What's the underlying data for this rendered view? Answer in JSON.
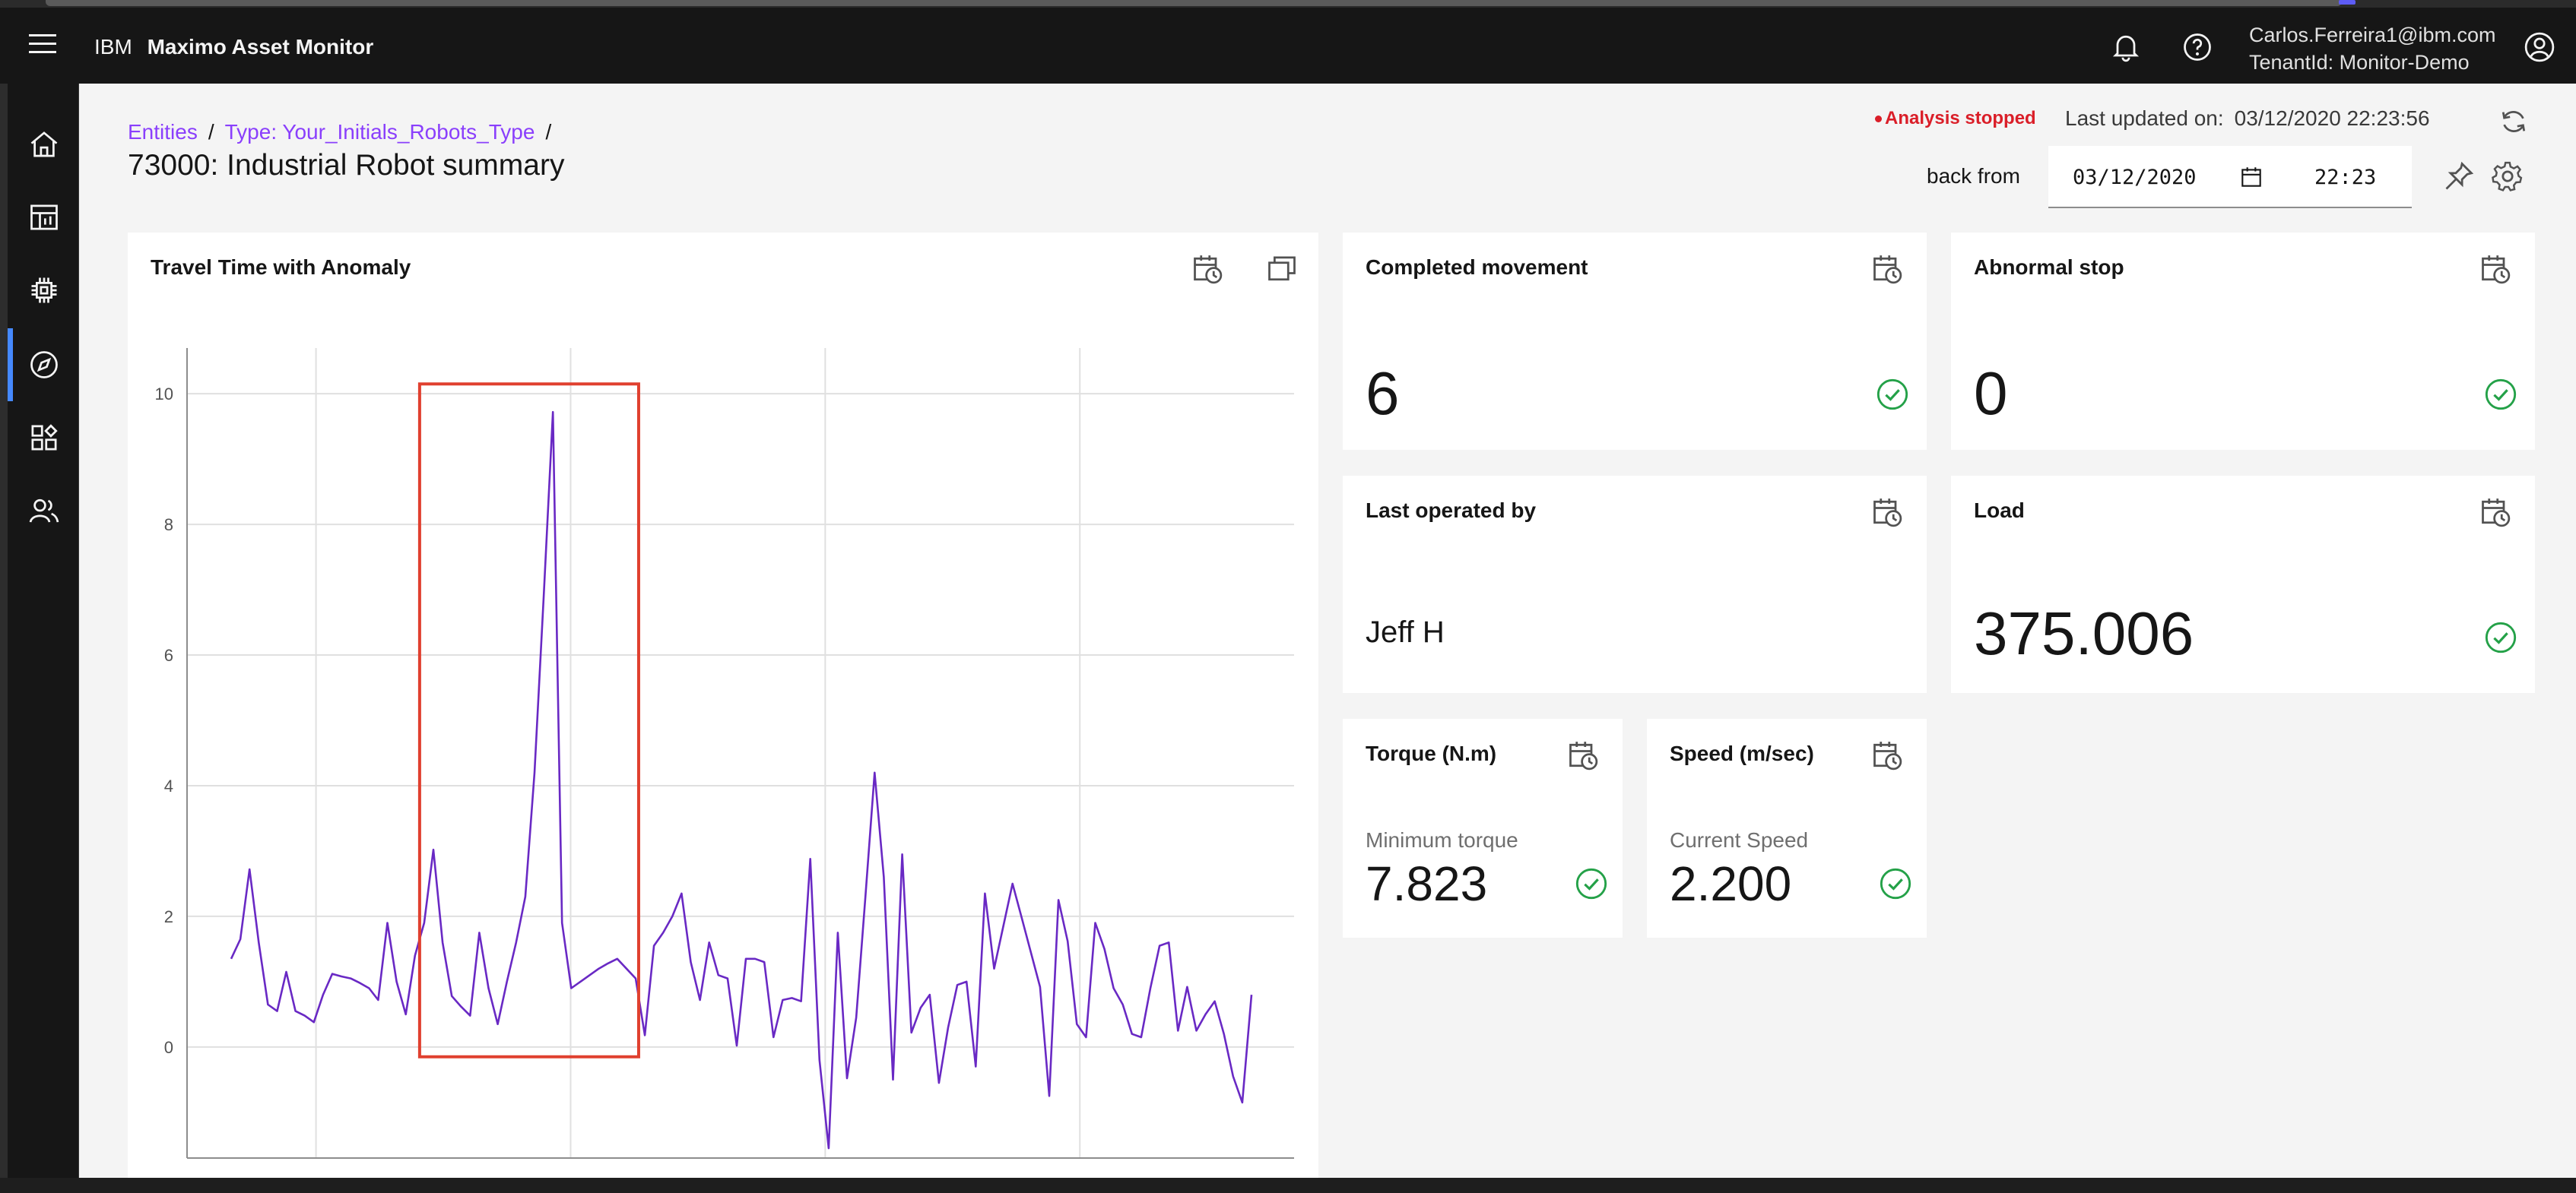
{
  "header": {
    "brand_company": "IBM",
    "brand_product": "Maximo Asset Monitor",
    "user_email": "Carlos.Ferreira1@ibm.com",
    "tenant": "TenantId: Monitor-Demo",
    "icons": [
      "notification-icon",
      "help-icon",
      "user-avatar-icon"
    ]
  },
  "leftnav": {
    "items": [
      "home-icon",
      "dashboard-icon",
      "chip-icon",
      "monitor-icon",
      "widgets-icon",
      "users-icon"
    ],
    "active": "monitor-icon"
  },
  "breadcrumb": {
    "items": [
      "Entities",
      "Type: Your_Initials_Robots_Type"
    ],
    "separator": "/"
  },
  "page": {
    "title": "73000: Industrial Robot summary",
    "status": "Analysis stopped",
    "last_updated_label": "Last updated on:",
    "last_updated_value": "03/12/2020 22:23:56",
    "back_from_label": "back from",
    "date_value": "03/12/2020",
    "time_value": "22:23"
  },
  "cards": {
    "completed_movement": {
      "title": "Completed movement",
      "value": "6"
    },
    "abnormal_stop": {
      "title": "Abnormal stop",
      "value": "0"
    },
    "last_operated_by": {
      "title": "Last operated by",
      "value": "Jeff H"
    },
    "load": {
      "title": "Load",
      "value": "375.006"
    },
    "torque": {
      "title": "Torque (N.m)",
      "label": "Minimum torque",
      "value": "7.823"
    },
    "speed": {
      "title": "Speed (m/sec)",
      "label": "Current Speed",
      "value": "2.200"
    }
  },
  "colors": {
    "accent": "#8a3ffc",
    "line": "#6929c4",
    "ok": "#24a148",
    "alert": "#da1e28",
    "highlight_box": "#e0402f"
  },
  "chart_data": {
    "type": "line",
    "title": "Travel Time with Anomaly",
    "ylim": [
      -1.7,
      10.7
    ],
    "yticks": [
      "0",
      "2",
      "4",
      "6",
      "8",
      "10"
    ],
    "ytick_values": [
      0,
      2,
      4,
      6,
      8,
      10
    ],
    "series": [
      {
        "values": [
          1.35,
          1.65,
          2.72,
          1.6,
          0.65,
          0.55,
          1.15,
          0.55,
          0.48,
          0.38,
          0.8,
          1.12,
          1.08,
          1.05,
          0.98,
          0.9,
          0.72,
          1.9,
          1.0,
          0.5,
          1.4,
          1.9,
          3.02,
          1.6,
          0.78,
          0.62,
          0.48,
          1.75,
          0.9,
          0.35,
          1.0,
          1.6,
          2.3,
          4.2,
          6.9,
          9.72,
          1.9,
          0.9,
          1.0,
          1.1,
          1.2,
          1.28,
          1.35,
          1.2,
          1.05,
          0.18,
          1.55,
          1.75,
          2.0,
          2.35,
          1.3,
          0.72,
          1.6,
          1.1,
          1.05,
          0.02,
          1.35,
          1.35,
          1.3,
          0.15,
          0.72,
          0.75,
          0.7,
          2.88,
          -0.2,
          -1.55,
          1.75,
          -0.48,
          0.45,
          2.3,
          4.2,
          2.6,
          -0.5,
          2.95,
          0.22,
          0.6,
          0.8,
          -0.55,
          0.3,
          0.95,
          1.0,
          -0.3,
          2.35,
          1.2,
          1.85,
          2.5,
          1.98,
          1.45,
          0.92,
          -0.75,
          2.25,
          1.62,
          0.35,
          0.15,
          1.9,
          1.5,
          0.9,
          0.65,
          0.2,
          0.15,
          0.9,
          1.55,
          1.6,
          0.25,
          0.92,
          0.25,
          0.5,
          0.7,
          0.2,
          -0.45,
          -0.85,
          0.8
        ]
      }
    ],
    "highlight_range_index": [
      21,
      44
    ],
    "highlight_ylim": [
      -0.15,
      10.15
    ]
  }
}
